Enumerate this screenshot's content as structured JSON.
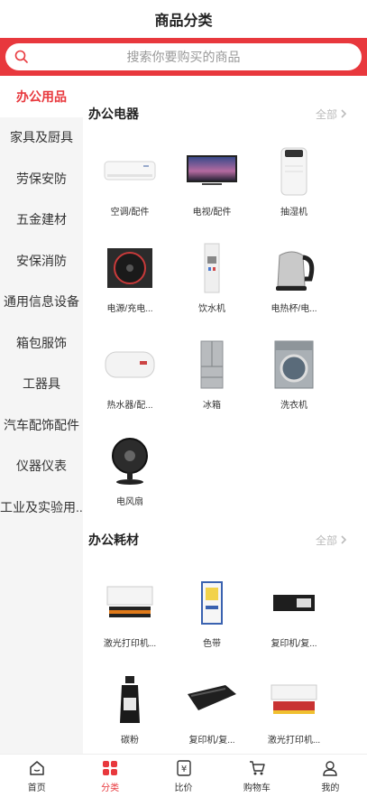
{
  "header": {
    "title": "商品分类"
  },
  "search": {
    "placeholder": "搜索你要购买的商品"
  },
  "sidebar": {
    "items": [
      {
        "label": "办公用品",
        "active": true
      },
      {
        "label": "家具及厨具"
      },
      {
        "label": "劳保安防"
      },
      {
        "label": "五金建材"
      },
      {
        "label": "安保消防"
      },
      {
        "label": "通用信息设备"
      },
      {
        "label": "箱包服饰"
      },
      {
        "label": "工器具"
      },
      {
        "label": "汽车配饰配件"
      },
      {
        "label": "仪器仪表"
      },
      {
        "label": "工业及实验用..."
      }
    ]
  },
  "sections": [
    {
      "title": "办公电器",
      "all_label": "全部",
      "items": [
        {
          "label": "空调/配件",
          "icon": "air-conditioner"
        },
        {
          "label": "电视/配件",
          "icon": "tv"
        },
        {
          "label": "抽湿机",
          "icon": "dehumidifier"
        },
        {
          "label": "电源/充电...",
          "icon": "power-supply"
        },
        {
          "label": "饮水机",
          "icon": "water-dispenser"
        },
        {
          "label": "电热杯/电...",
          "icon": "electric-kettle"
        },
        {
          "label": "热水器/配...",
          "icon": "water-heater"
        },
        {
          "label": "冰箱",
          "icon": "refrigerator"
        },
        {
          "label": "洗衣机",
          "icon": "washing-machine"
        },
        {
          "label": "电风扇",
          "icon": "electric-fan"
        }
      ]
    },
    {
      "title": "办公耗材",
      "all_label": "全部",
      "items": [
        {
          "label": "激光打印机...",
          "icon": "laser-toner"
        },
        {
          "label": "色带",
          "icon": "ribbon"
        },
        {
          "label": "复印机/复...",
          "icon": "copier-toner"
        },
        {
          "label": "碳粉",
          "icon": "toner-bottle"
        },
        {
          "label": "复印机/复...",
          "icon": "drum-unit"
        },
        {
          "label": "激光打印机...",
          "icon": "laser-cartridge"
        }
      ]
    }
  ],
  "tabbar": {
    "tabs": [
      {
        "label": "首页",
        "icon": "home-icon"
      },
      {
        "label": "分类",
        "icon": "category-icon",
        "active": true
      },
      {
        "label": "比价",
        "icon": "yen-icon"
      },
      {
        "label": "购物车",
        "icon": "cart-icon"
      },
      {
        "label": "我的",
        "icon": "user-icon"
      }
    ]
  },
  "colors": {
    "accent": "#e8383d",
    "sidebar_bg": "#f5f5f5"
  }
}
